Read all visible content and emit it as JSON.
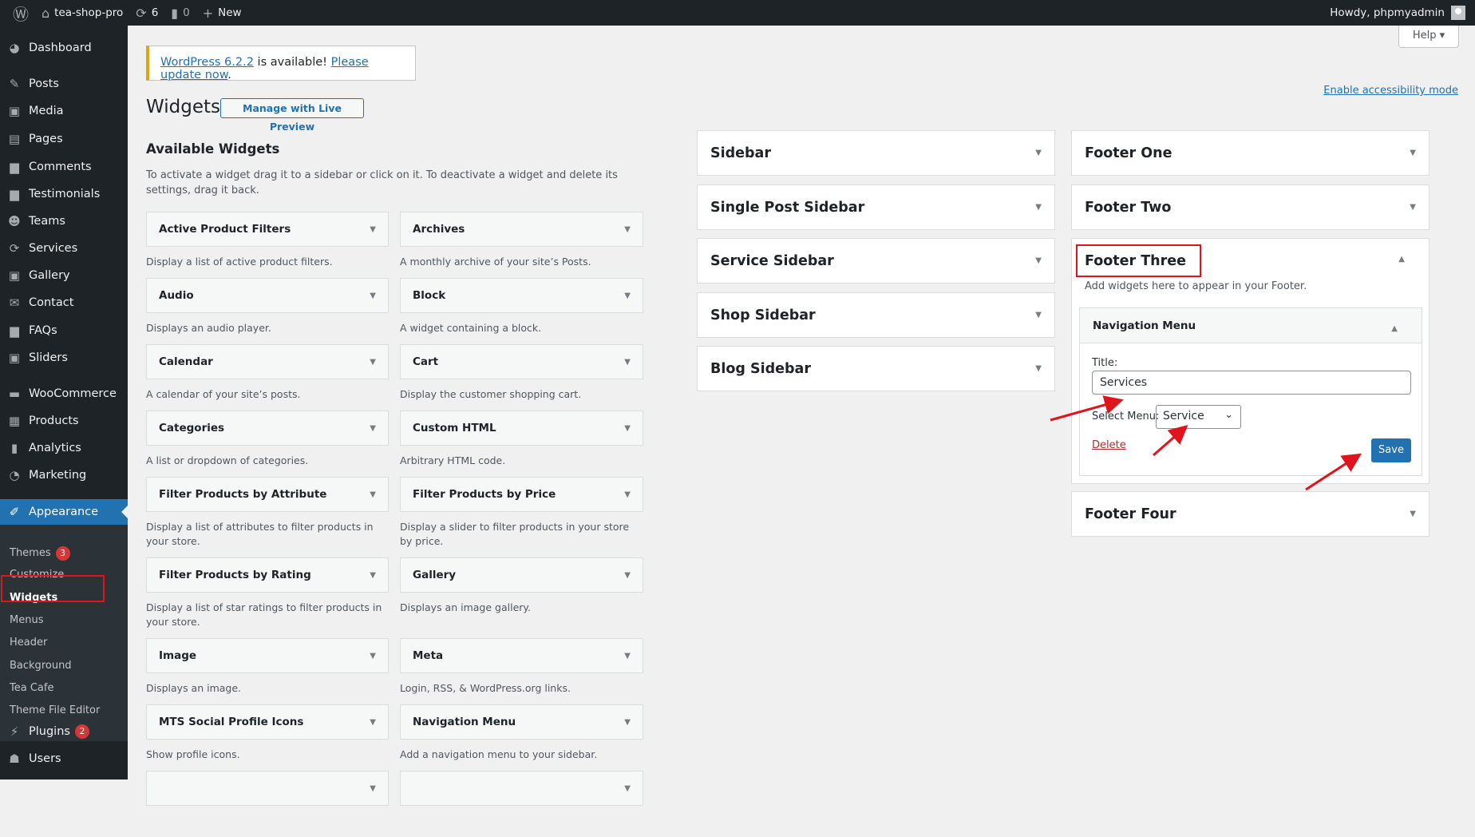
{
  "adminbar": {
    "site": "tea-shop-pro",
    "updates": "6",
    "comments": "0",
    "new": "New",
    "howdy": "Howdy, phpmyadmin"
  },
  "menu": {
    "items": [
      {
        "label": "Dashboard",
        "icon": "dashboard-icon",
        "glyph": "◕"
      },
      {
        "label": "Posts",
        "icon": "pin-icon",
        "glyph": "✎"
      },
      {
        "label": "Media",
        "icon": "media-icon",
        "glyph": "▣"
      },
      {
        "label": "Pages",
        "icon": "pages-icon",
        "glyph": "▤"
      },
      {
        "label": "Comments",
        "icon": "comments-icon",
        "glyph": "▆"
      },
      {
        "label": "Testimonials",
        "icon": "testimonials-icon",
        "glyph": "▆"
      },
      {
        "label": "Teams",
        "icon": "teams-icon",
        "glyph": "☻"
      },
      {
        "label": "Services",
        "icon": "services-icon",
        "glyph": "⟳"
      },
      {
        "label": "Gallery",
        "icon": "gallery-icon",
        "glyph": "▣"
      },
      {
        "label": "Contact",
        "icon": "mail-icon",
        "glyph": "✉"
      },
      {
        "label": "FAQs",
        "icon": "faq-icon",
        "glyph": "▆"
      },
      {
        "label": "Sliders",
        "icon": "sliders-icon",
        "glyph": "▣"
      },
      {
        "label": "WooCommerce",
        "icon": "woocommerce-icon",
        "glyph": "▬"
      },
      {
        "label": "Products",
        "icon": "products-icon",
        "glyph": "▦"
      },
      {
        "label": "Analytics",
        "icon": "analytics-icon",
        "glyph": "▮"
      },
      {
        "label": "Marketing",
        "icon": "marketing-icon",
        "glyph": "◔"
      },
      {
        "label": "Appearance",
        "icon": "appearance-icon",
        "glyph": "✐",
        "active": true
      },
      {
        "label": "Plugins",
        "icon": "plugins-icon",
        "glyph": "⚡",
        "badge": "2"
      },
      {
        "label": "Users",
        "icon": "users-icon",
        "glyph": "☗"
      }
    ],
    "submenu": [
      {
        "label": "Themes",
        "badge": "3"
      },
      {
        "label": "Customize"
      },
      {
        "label": "Widgets",
        "current": true
      },
      {
        "label": "Menus"
      },
      {
        "label": "Header"
      },
      {
        "label": "Background"
      },
      {
        "label": "Tea Cafe"
      },
      {
        "label": "Theme File Editor"
      }
    ]
  },
  "notice": {
    "version_link": "WordPress 6.2.2",
    "middle": " is available! ",
    "update_link": "Please update now",
    "end": "."
  },
  "header": {
    "title": "Widgets",
    "live_preview": "Manage with Live Preview",
    "help": "Help ▾",
    "accessibility": "Enable accessibility mode"
  },
  "available": {
    "heading": "Available Widgets",
    "description": "To activate a widget drag it to a sidebar or click on it. To deactivate a widget and delete its settings, drag it back.",
    "widgets": [
      {
        "title": "Active Product Filters",
        "desc": "Display a list of active product filters."
      },
      {
        "title": "Archives",
        "desc": "A monthly archive of your site’s Posts."
      },
      {
        "title": "Audio",
        "desc": "Displays an audio player."
      },
      {
        "title": "Block",
        "desc": "A widget containing a block."
      },
      {
        "title": "Calendar",
        "desc": "A calendar of your site’s posts."
      },
      {
        "title": "Cart",
        "desc": "Display the customer shopping cart."
      },
      {
        "title": "Categories",
        "desc": "A list or dropdown of categories."
      },
      {
        "title": "Custom HTML",
        "desc": "Arbitrary HTML code."
      },
      {
        "title": "Filter Products by Attribute",
        "desc": "Display a list of attributes to filter products in your store."
      },
      {
        "title": "Filter Products by Price",
        "desc": "Display a slider to filter products in your store by price."
      },
      {
        "title": "Filter Products by Rating",
        "desc": "Display a list of star ratings to filter products in your store."
      },
      {
        "title": "Gallery",
        "desc": "Displays an image gallery."
      },
      {
        "title": "Image",
        "desc": "Displays an image."
      },
      {
        "title": "Meta",
        "desc": "Login, RSS, & WordPress.org links."
      },
      {
        "title": "MTS Social Profile Icons",
        "desc": "Show profile icons."
      },
      {
        "title": "Navigation Menu",
        "desc": "Add a navigation menu to your sidebar."
      },
      {
        "title": "",
        "desc": ""
      },
      {
        "title": "",
        "desc": ""
      }
    ]
  },
  "areas_left": [
    "Sidebar",
    "Single Post Sidebar",
    "Service Sidebar",
    "Shop Sidebar",
    "Blog Sidebar"
  ],
  "areas_right": {
    "footer_one": "Footer One",
    "footer_two": "Footer Two",
    "footer_four": "Footer Four"
  },
  "footer_three": {
    "title": "Footer Three",
    "description": "Add widgets here to appear in your Footer.",
    "widget": {
      "name": "Navigation Menu",
      "title_label": "Title:",
      "title_value": "Services",
      "select_label": "Select Menu:",
      "select_value": "Service",
      "delete": "Delete",
      "save": "Save"
    }
  },
  "colors": {
    "accent": "#2271b1",
    "admin_dark": "#1d2327",
    "annotation": "#e0141c",
    "delete": "#b32d2e"
  }
}
